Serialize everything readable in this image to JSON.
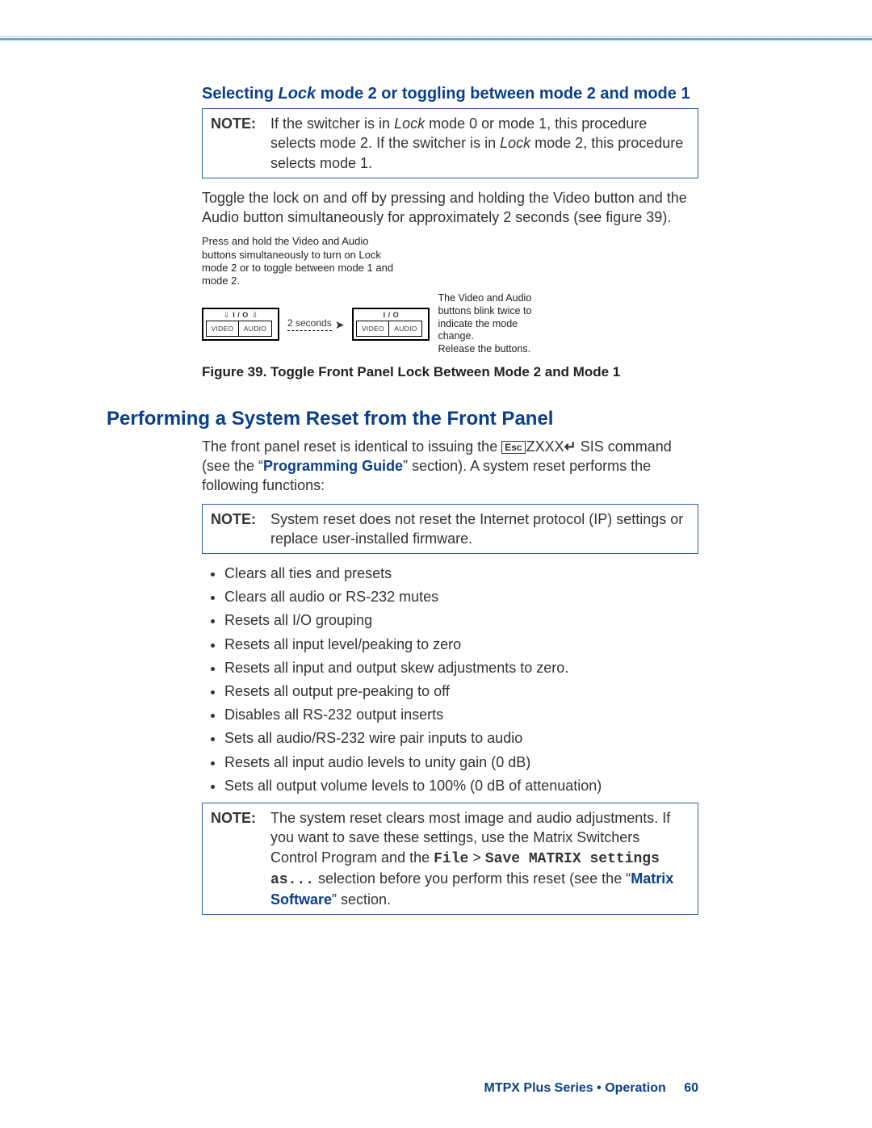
{
  "section1": {
    "heading_pre": "Selecting ",
    "heading_italic": "Lock",
    "heading_post": " mode 2 or toggling between mode 2 and mode 1",
    "note_label": "NOTE:",
    "note1_a": "If the switcher is in ",
    "note1_italic1": "Lock",
    "note1_b": " mode 0 or mode 1, this procedure selects mode 2. If the switcher is in ",
    "note1_italic2": "Lock",
    "note1_c": " mode 2, this procedure selects mode 1.",
    "para1": "Toggle the lock on and off by pressing and holding the Video button and the Audio button simultaneously for approximately 2 seconds (see figure 39).",
    "fig_intro": "Press and hold the Video and Audio buttons simultaneously to turn on Lock mode 2 or to toggle between mode 1 and mode 2.",
    "panel_io": "I / O",
    "panel_video": "VIDEO",
    "panel_audio": "AUDIO",
    "mid_label": "2 seconds",
    "side_note": "The Video and Audio buttons blink twice to indicate the mode change.\nRelease the buttons.",
    "fig_caption": "Figure 39. Toggle Front Panel Lock Between Mode 2 and Mode 1"
  },
  "section2": {
    "heading": "Performing a System Reset from the Front Panel",
    "para_a": "The front panel reset is identical to issuing the ",
    "esc": "Esc",
    "para_b": "ZXXX",
    "para_c": " SIS command (see the “",
    "link1": "Programming Guide",
    "para_d": "” section). A system reset performs the following functions:",
    "note_label": "NOTE:",
    "note2": "System reset does not reset the Internet protocol (IP) settings or replace user-installed firmware.",
    "bullets": [
      "Clears all ties and presets",
      "Clears all audio or RS-232 mutes",
      "Resets all I/O grouping",
      "Resets all input level/peaking to zero",
      "Resets all input and output skew adjustments to zero.",
      "Resets all output pre-peaking to off",
      "Disables all RS-232 output inserts",
      "Sets all audio/RS-232 wire pair inputs to audio",
      "Resets all input audio levels to unity gain (0 dB)",
      "Sets all output volume levels to 100% (0 dB of attenuation)"
    ],
    "note3_a": "The system reset clears most image and audio adjustments. If you want to save these settings, use the Matrix Switchers Control Program and the ",
    "note3_mono1": "File",
    "note3_gt": " > ",
    "note3_mono2": "Save MATRIX settings as...",
    "note3_b": " selection before you perform this reset (see the “",
    "link2": "Matrix Software",
    "note3_c": "” section."
  },
  "footer": {
    "text": "MTPX Plus Series • Operation",
    "page": "60"
  }
}
